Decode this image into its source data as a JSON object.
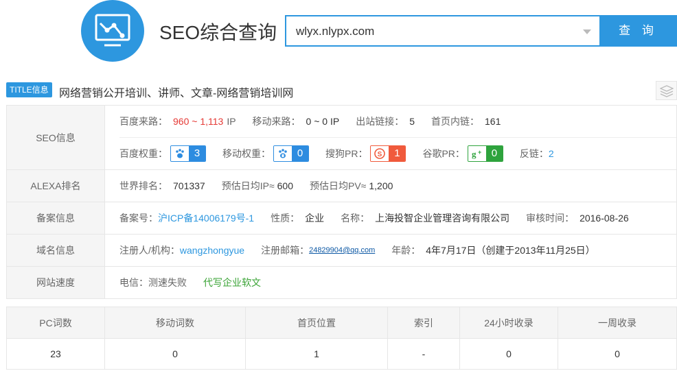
{
  "header": {
    "title": "SEO综合查询",
    "search_value": "wlyx.nlypx.com",
    "search_button": "查 询",
    "logo_icon": "chart-monitor-icon"
  },
  "title_info": {
    "badge": "TITLE信息",
    "text": "网络营销公开培训、讲师、文章-网络营销培训网",
    "stack_icon": "layers-icon"
  },
  "seo": {
    "label": "SEO信息",
    "baidu_traffic_label": "百度来路：",
    "baidu_traffic_value": "960 ~ 1,113",
    "baidu_traffic_unit": "IP",
    "mobile_traffic_label": "移动来路：",
    "mobile_traffic_value": "0 ~ 0 IP",
    "outbound_label": "出站链接：",
    "outbound_value": "5",
    "inner_links_label": "首页内链：",
    "inner_links_value": "161",
    "baidu_weight_label": "百度权重：",
    "baidu_weight_value": "3",
    "mobile_weight_label": "移动权重：",
    "mobile_weight_value": "0",
    "sogou_label": "搜狗PR：",
    "sogou_value": "1",
    "google_label": "谷歌PR：",
    "google_value": "0",
    "backlinks_label": "反链：",
    "backlinks_value": "2"
  },
  "alexa": {
    "label": "ALEXA排名",
    "world_rank_label": "世界排名：",
    "world_rank_value": "701337",
    "daily_ip_label": "预估日均IP≈",
    "daily_ip_value": "600",
    "daily_pv_label": "预估日均PV≈",
    "daily_pv_value": "1,200"
  },
  "icp": {
    "label": "备案信息",
    "number_label": "备案号：",
    "number_value": "沪ICP备14006179号-1",
    "nature_label": "性质：",
    "nature_value": "企业",
    "name_label": "名称：",
    "name_value": "上海投智企业管理咨询有限公司",
    "review_label": "审核时间：",
    "review_value": "2016-08-26"
  },
  "domain": {
    "label": "域名信息",
    "registrant_label": "注册人/机构：",
    "registrant_value": "wangzhongyue",
    "email_label": "注册邮箱：",
    "email_value": "24829904@qq.com",
    "age_label": "年龄：",
    "age_value": "4年7月17日（创建于2013年11月25日）"
  },
  "speed": {
    "label": "网站速度",
    "telecom_label": "电信：",
    "telecom_value": "测速失败",
    "ad_link": "代写企业软文"
  },
  "keywords": {
    "headers": [
      "PC词数",
      "移动词数",
      "首页位置",
      "索引",
      "24小时收录",
      "一周收录"
    ],
    "values": [
      "23",
      "0",
      "1",
      "-",
      "0",
      "0"
    ]
  },
  "colors": {
    "accent": "#2d97df",
    "traffic_red": "#e53935",
    "baidu_blue": "#2d8ce0",
    "sogou_red": "#f05a3c",
    "google_green": "#2ea33d",
    "ad_green": "#3aa335"
  }
}
